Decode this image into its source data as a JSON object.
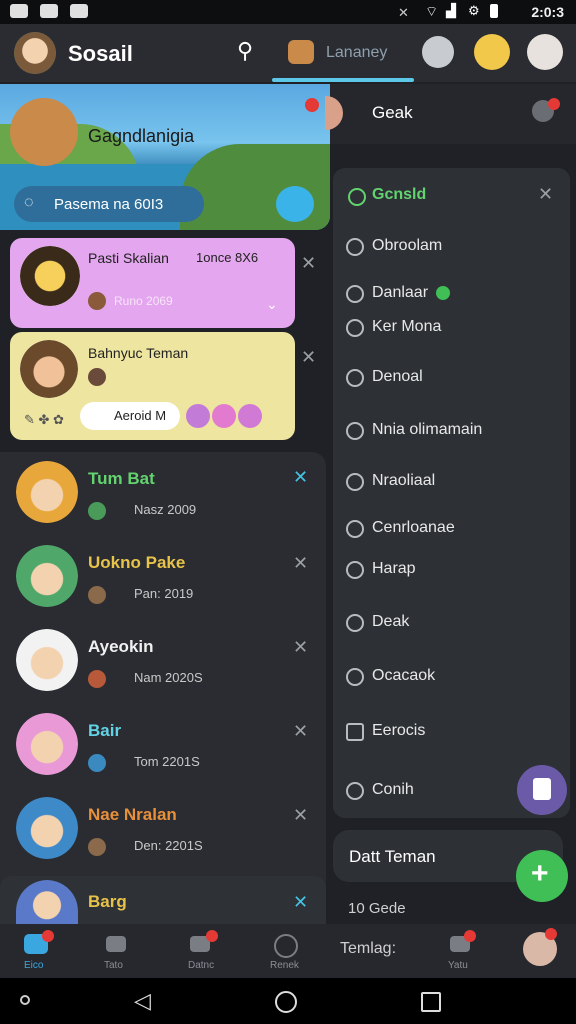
{
  "app": {
    "title": "Sosail"
  },
  "status_bar": {
    "time": "2:0:3"
  },
  "header": {
    "tab_label": "Lananey"
  },
  "banner": {
    "title": "Gagndlanigia",
    "pill_text": "Pasema na 60I3"
  },
  "cards": [
    {
      "title": "Pasti Skalian",
      "extra": "1once 8X6",
      "sub": "Runo 2069"
    },
    {
      "title": "Bahnyuc Teman",
      "button": "Aeroid M"
    }
  ],
  "chats": [
    {
      "name": "Tum Bat",
      "sub": "Nasz 2009",
      "color": "#e8a73a"
    },
    {
      "name": "Uokno Pake",
      "sub": "Pan: 2019",
      "color": "#4fa86a"
    },
    {
      "name": "Ayeokin",
      "sub": "Nam 2020S",
      "color": "#f2f2f2"
    },
    {
      "name": "Bair",
      "sub": "Tom 2201S",
      "color": "#e99ad6"
    },
    {
      "name": "Nae Nralan",
      "sub": "Den: 2201S",
      "color": "#3e8ac9"
    },
    {
      "name": "Barg",
      "sub": "",
      "color": "#5a7ac9"
    }
  ],
  "right_header": {
    "label": "Geak"
  },
  "menu": {
    "active": "Gcnsld",
    "items": [
      "Obroolam",
      "Danlaar",
      "Ker Mona",
      "Denoal",
      "Nnia olimamain",
      "Nraoliaal",
      "Cenrloanae",
      "Harap",
      "Deak",
      "Ocacaok",
      "Eerocis",
      "Conih"
    ]
  },
  "dat_teman": "Datt Teman",
  "bottom_hint": "10 Gede",
  "bottom_nav": {
    "items": [
      "Eico",
      "Tato",
      "Datnc",
      "Renek",
      "Temlag:",
      "Yatu"
    ]
  },
  "colors": {
    "accent": "#5cc7e6",
    "green": "#3fbf56",
    "purple_card": "#e4a6ee",
    "yellow_card": "#eee6a0"
  }
}
